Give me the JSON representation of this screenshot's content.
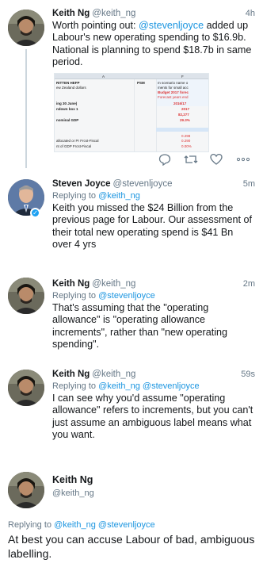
{
  "tweets": [
    {
      "name": "Keith Ng",
      "handle": "@keith_ng",
      "time": "4h",
      "text_before": "Worth pointing out: ",
      "mention": "@stevenljoyce",
      "text_after": " added up Labour's new operating spending to $16.9b. National is planning to spend $18.7b in same period.",
      "avatar": "keith-avatar"
    },
    {
      "name": "Steven Joyce",
      "handle": "@stevenljoyce",
      "time": "5m",
      "replying_label": "Replying to ",
      "replying_to": "@keith_ng",
      "text": "Keith you missed the $24 Billion from the previous page for Labour. Our assessment of their total new operating spend is $41 Bn over 4 yrs",
      "avatar": "steven-avatar"
    },
    {
      "name": "Keith Ng",
      "handle": "@keith_ng",
      "time": "2m",
      "replying_label": "Replying to ",
      "replying_to": "@stevenljoyce",
      "text": "That's assuming that the \"operating allowance\" is \"operating allowance increments\", rather than \"new operating spending\".",
      "avatar": "keith-avatar"
    },
    {
      "name": "Keith Ng",
      "handle": "@keith_ng",
      "time": "59s",
      "replying_label": "Replying to ",
      "replying_to": "@keith_ng @stevenljoyce",
      "text": "I can see why you'd assume \"operating allowance\" refers to increments, but you can't just assume an ambiguous label means what you want.",
      "avatar": "keith-avatar"
    },
    {
      "name": "Keith Ng",
      "handle": "@keith_ng",
      "replying_label": "Replying to ",
      "replying_to": "@keith_ng @stevenljoyce",
      "text": "At best you can accuse Labour of bad, ambiguous labelling.",
      "avatar": "keith-avatar"
    }
  ],
  "sheet": {
    "col_a": "A",
    "col_f": "F",
    "r1a": "RITTEN HEFP",
    "r1b": "PSM",
    "r1c": "m scenario name o",
    "r2a": "ew Zealand dollars",
    "r2c": "ments for small acc",
    "r3c": "Budget 2017 forec",
    "r4c": "Forecast years end",
    "r5a": "ing 30 June)",
    "r5c": "2016/17",
    "r6a": "ndown box  1",
    "r6c": "2017",
    "r7c": "82,277",
    "r8a": "nominal GDP",
    "r8c": "29.3%",
    "r9c": "0.298",
    "r10a": "allocated or Pr Frcst-Fiscal",
    "r10c": "0.290",
    "r11a": "nt of GDP    Frcst-Fiscal",
    "r11c": "0.00%"
  },
  "actions": {
    "reply_icon": "reply-icon",
    "retweet_icon": "retweet-icon",
    "like_icon": "heart-icon",
    "more_icon": "more-icon",
    "reply": "◯",
    "retweet": "⇄",
    "like": "♡",
    "more": "∘∘∘"
  },
  "colors": {
    "link": "#1b95e0",
    "muted": "#657786",
    "text": "#14171a",
    "verified": "#1da1f2"
  }
}
